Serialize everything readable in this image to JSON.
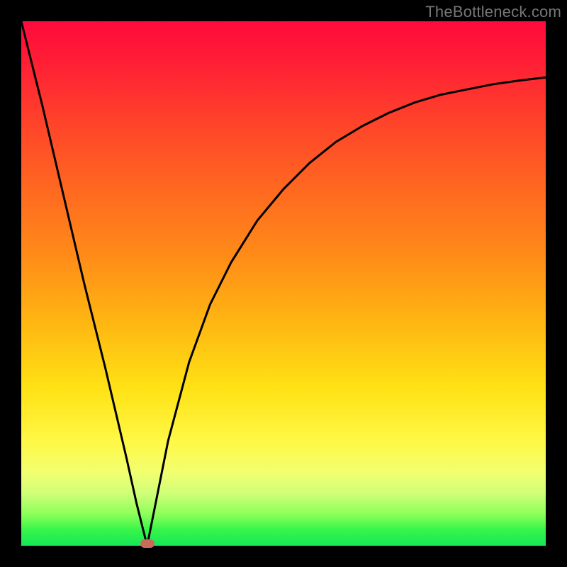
{
  "attribution": "TheBottleneck.com",
  "chart_data": {
    "type": "line",
    "title": "",
    "xlabel": "",
    "ylabel": "",
    "xlim": [
      0,
      100
    ],
    "ylim": [
      0,
      100
    ],
    "background_gradient": {
      "orientation": "vertical",
      "stops": [
        {
          "pos": 0.0,
          "color": "#ff0a3c",
          "meaning": "severe bottleneck"
        },
        {
          "pos": 0.5,
          "color": "#ffa015",
          "meaning": "moderate"
        },
        {
          "pos": 0.8,
          "color": "#fff845",
          "meaning": "mild"
        },
        {
          "pos": 1.0,
          "color": "#15e858",
          "meaning": "balanced"
        }
      ]
    },
    "optimum_x": 24,
    "marker": {
      "x": 24,
      "y": 0,
      "color": "#c96a5a"
    },
    "series": [
      {
        "name": "bottleneck-curve",
        "x": [
          0,
          4,
          8,
          12,
          16,
          20,
          22,
          24,
          26,
          28,
          32,
          36,
          40,
          45,
          50,
          55,
          60,
          65,
          70,
          75,
          80,
          85,
          90,
          95,
          100
        ],
        "values": [
          100,
          84,
          67,
          50,
          34,
          17,
          8,
          0,
          10,
          20,
          35,
          46,
          54,
          62,
          68,
          73,
          77,
          80,
          82.5,
          84.5,
          86,
          87,
          88,
          88.7,
          89.3
        ]
      }
    ],
    "note": "Values estimated from pixel positions; y=0 at bottom (green/balanced), y=100 at top (red/severe)."
  }
}
